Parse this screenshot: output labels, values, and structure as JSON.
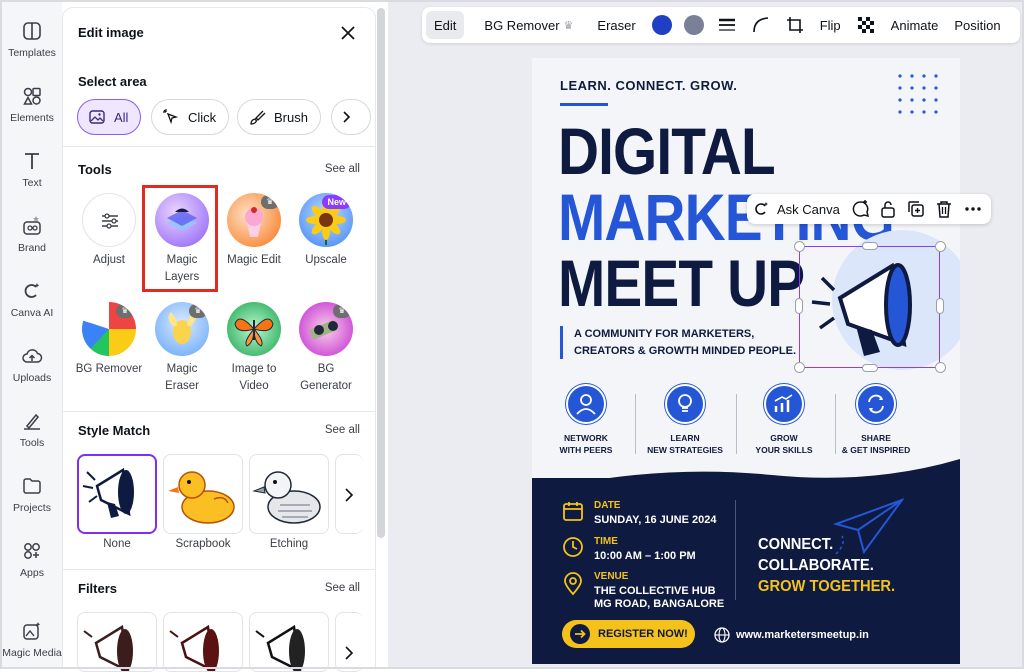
{
  "rail": {
    "items": [
      {
        "label": "Templates",
        "icon": "templates-icon"
      },
      {
        "label": "Elements",
        "icon": "elements-icon"
      },
      {
        "label": "Text",
        "icon": "text-icon"
      },
      {
        "label": "Brand",
        "icon": "brand-icon"
      },
      {
        "label": "Canva AI",
        "icon": "canva-ai-icon"
      },
      {
        "label": "Uploads",
        "icon": "uploads-icon"
      },
      {
        "label": "Tools",
        "icon": "tools-icon"
      },
      {
        "label": "Projects",
        "icon": "projects-icon"
      },
      {
        "label": "Apps",
        "icon": "apps-icon"
      },
      {
        "label": "Magic Media",
        "icon": "magic-media-icon"
      }
    ]
  },
  "panel": {
    "title": "Edit image",
    "select_area": {
      "heading": "Select area",
      "options": [
        "All",
        "Click",
        "Brush"
      ],
      "selected": "All"
    },
    "tools": {
      "heading": "Tools",
      "see_all": "See all",
      "items": [
        {
          "label": "Adjust"
        },
        {
          "label": "Magic Layers"
        },
        {
          "label": "Magic Edit"
        },
        {
          "label": "Upscale",
          "badge": "New"
        },
        {
          "label": "BG Remover"
        },
        {
          "label": "Magic Eraser"
        },
        {
          "label": "Image to Video"
        },
        {
          "label": "BG Generator"
        }
      ]
    },
    "style_match": {
      "heading": "Style Match",
      "see_all": "See all",
      "items": [
        "None",
        "Scrapbook",
        "Etching"
      ],
      "selected": "None"
    },
    "filters": {
      "heading": "Filters",
      "see_all": "See all"
    }
  },
  "toolbar": {
    "edit": "Edit",
    "bg_remover": "BG Remover",
    "eraser": "Eraser",
    "flip": "Flip",
    "animate": "Animate",
    "position": "Position",
    "color1": "#1f3fc4",
    "color2": "#7a8096"
  },
  "context_menu": {
    "ask": "Ask Canva"
  },
  "poster": {
    "tagline": "LEARN. CONNECT. GROW.",
    "title_line1": "DIGITAL",
    "title_line2": "MARKETING",
    "title_line3": "MEET UP",
    "subtitle_line1": "A COMMUNITY FOR MARKETERS,",
    "subtitle_line2": "CREATORS & GROWTH MINDED PEOPLE.",
    "features": [
      {
        "line1": "NETWORK",
        "line2": "WITH PEERS"
      },
      {
        "line1": "LEARN",
        "line2": "NEW STRATEGIES"
      },
      {
        "line1": "GROW",
        "line2": "YOUR SKILLS"
      },
      {
        "line1": "SHARE",
        "line2": "& GET INSPIRED"
      }
    ],
    "date_label": "DATE",
    "date_value": "SUNDAY, 16 JUNE 2024",
    "time_label": "TIME",
    "time_value": "10:00 AM – 1:00 PM",
    "venue_label": "VENUE",
    "venue_line1": "THE COLLECTIVE HUB",
    "venue_line2": "MG ROAD, BANGALORE",
    "slogan1": "CONNECT.",
    "slogan2": "COLLABORATE.",
    "slogan3": "GROW TOGETHER.",
    "register": "REGISTER NOW!",
    "website": "www.marketersmeetup.in",
    "navy": "#0e1a3f",
    "blue": "#2456d6",
    "yellow": "#f4c21a"
  }
}
